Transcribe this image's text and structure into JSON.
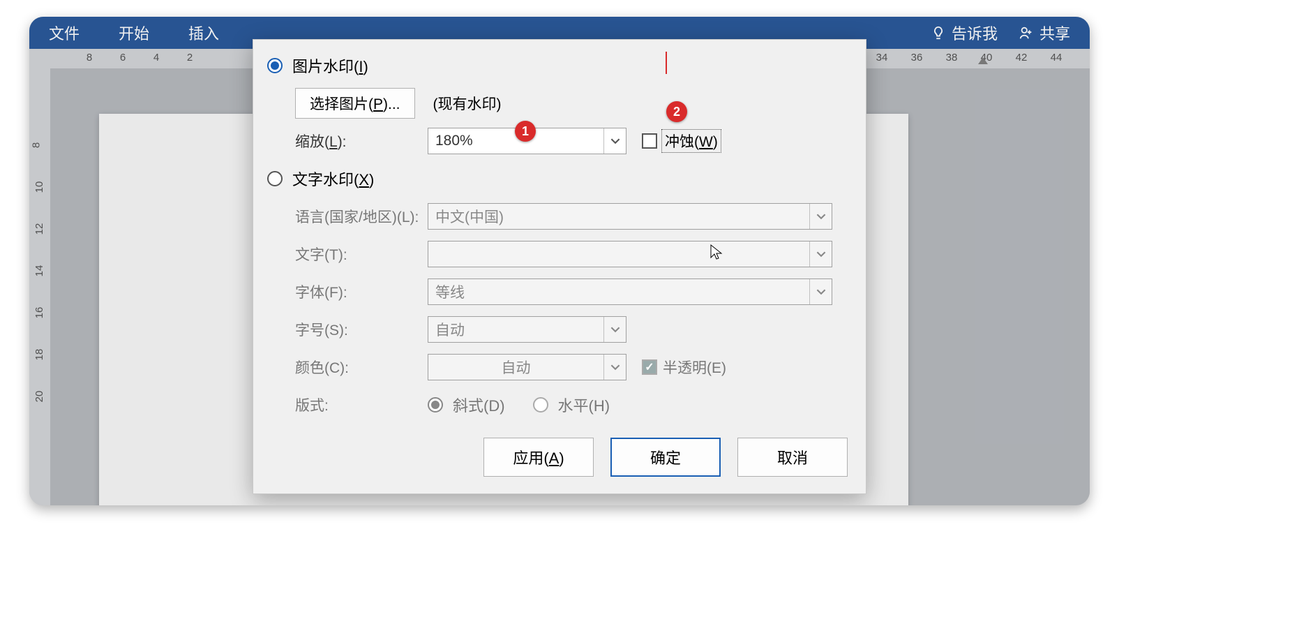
{
  "ribbon": {
    "tabs": [
      "文件",
      "开始",
      "插入"
    ],
    "right": {
      "tellme": "告诉我",
      "share": "共享"
    }
  },
  "hruler": {
    "left": [
      "8",
      "6",
      "4",
      "2"
    ],
    "right": [
      "34",
      "36",
      "38",
      "40",
      "42",
      "44"
    ]
  },
  "vruler": [
    "8",
    "10",
    "12",
    "14",
    "16",
    "18",
    "20"
  ],
  "dialog": {
    "imageWatermark": {
      "label": "图片水印(",
      "hot": "I",
      "tail": ")"
    },
    "selectPicture": {
      "label": "选择图片(",
      "hot": "P",
      "tail": ")..."
    },
    "existing": "(现有水印)",
    "scale": {
      "label": "缩放(",
      "hot": "L",
      "tail": "):",
      "value": "180%"
    },
    "washout": {
      "label": "冲蚀(",
      "hot": "W",
      "tail": ")"
    },
    "textWatermark": {
      "label": "文字水印(",
      "hot": "X",
      "tail": ")"
    },
    "language": {
      "label": "语言(国家/地区)(L):",
      "value": "中文(中国)"
    },
    "text": {
      "label": "文字(T):",
      "value": ""
    },
    "font": {
      "label": "字体(F):",
      "value": "等线"
    },
    "fontsize": {
      "label": "字号(S):",
      "value": "自动"
    },
    "color": {
      "label": "颜色(C):",
      "value": "自动"
    },
    "semitrans": "半透明(E)",
    "layout": {
      "label": "版式:",
      "diag": "斜式(D)",
      "horiz": "水平(H)"
    },
    "buttons": {
      "apply": "应用(",
      "applyHot": "A",
      "applyTail": ")",
      "ok": "确定",
      "cancel": "取消"
    }
  },
  "badges": {
    "b1": "1",
    "b2": "2"
  }
}
